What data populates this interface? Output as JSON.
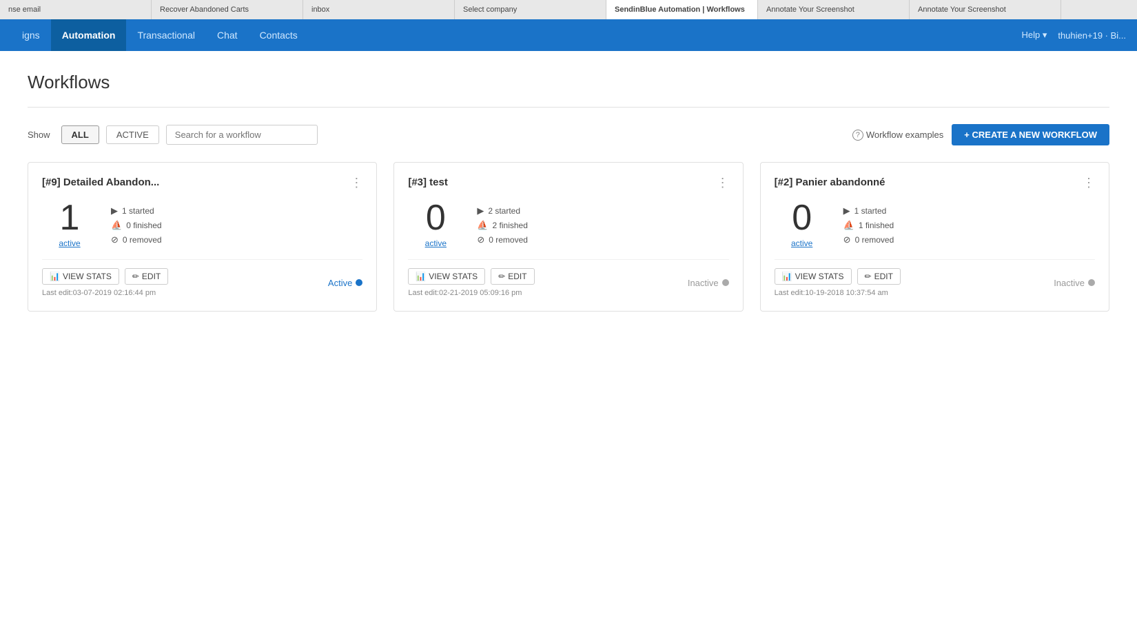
{
  "browser": {
    "tabs": [
      {
        "label": "nse email",
        "active": false
      },
      {
        "label": "Recover Abandoned Carts",
        "active": false
      },
      {
        "label": "inbox",
        "active": false
      },
      {
        "label": "Select company",
        "active": false
      },
      {
        "label": "SendinBlue Automation | Workflows",
        "active": true
      },
      {
        "label": "Annotate Your Screenshot",
        "active": false
      },
      {
        "label": "Annotate Your Screenshot",
        "active": false
      }
    ]
  },
  "navbar": {
    "items": [
      {
        "label": "igns",
        "active": false
      },
      {
        "label": "Automation",
        "active": true
      },
      {
        "label": "Transactional",
        "active": false
      },
      {
        "label": "Chat",
        "active": false
      },
      {
        "label": "Contacts",
        "active": false
      }
    ],
    "right": {
      "help": "Help ▾",
      "user": "thuhien+19 · Bi..."
    }
  },
  "page": {
    "title": "Workflows"
  },
  "filter": {
    "show_label": "Show",
    "all_btn": "ALL",
    "active_btn": "ACTIVE",
    "search_placeholder": "Search for a workflow",
    "examples_label": "Workflow examples",
    "create_btn": "+ CREATE A NEW WORKFLOW"
  },
  "workflows": [
    {
      "id": "workflow-1",
      "title": "[#9] Detailed Abandon...",
      "count": "1",
      "count_label": "active",
      "stats": [
        {
          "icon": "▶",
          "value": "1 started"
        },
        {
          "icon": "⛵",
          "value": "0 finished"
        },
        {
          "icon": "⊘",
          "value": "0 removed"
        }
      ],
      "status": "Active",
      "status_type": "active",
      "view_stats_btn": "VIEW STATS",
      "edit_btn": "EDIT",
      "last_edit": "Last edit:03-07-2019 02:16:44 pm"
    },
    {
      "id": "workflow-2",
      "title": "[#3] test",
      "count": "0",
      "count_label": "active",
      "stats": [
        {
          "icon": "▶",
          "value": "2 started"
        },
        {
          "icon": "⛵",
          "value": "2 finished"
        },
        {
          "icon": "⊘",
          "value": "0 removed"
        }
      ],
      "status": "Inactive",
      "status_type": "inactive",
      "view_stats_btn": "VIEW STATS",
      "edit_btn": "EDIT",
      "last_edit": "Last edit:02-21-2019 05:09:16 pm"
    },
    {
      "id": "workflow-3",
      "title": "[#2] Panier abandonné",
      "count": "0",
      "count_label": "active",
      "stats": [
        {
          "icon": "▶",
          "value": "1 started"
        },
        {
          "icon": "⛵",
          "value": "1 finished"
        },
        {
          "icon": "⊘",
          "value": "0 removed"
        }
      ],
      "status": "Inactive",
      "status_type": "inactive",
      "view_stats_btn": "VIEW STATS",
      "edit_btn": "EDIT",
      "last_edit": "Last edit:10-19-2018 10:37:54 am"
    }
  ]
}
